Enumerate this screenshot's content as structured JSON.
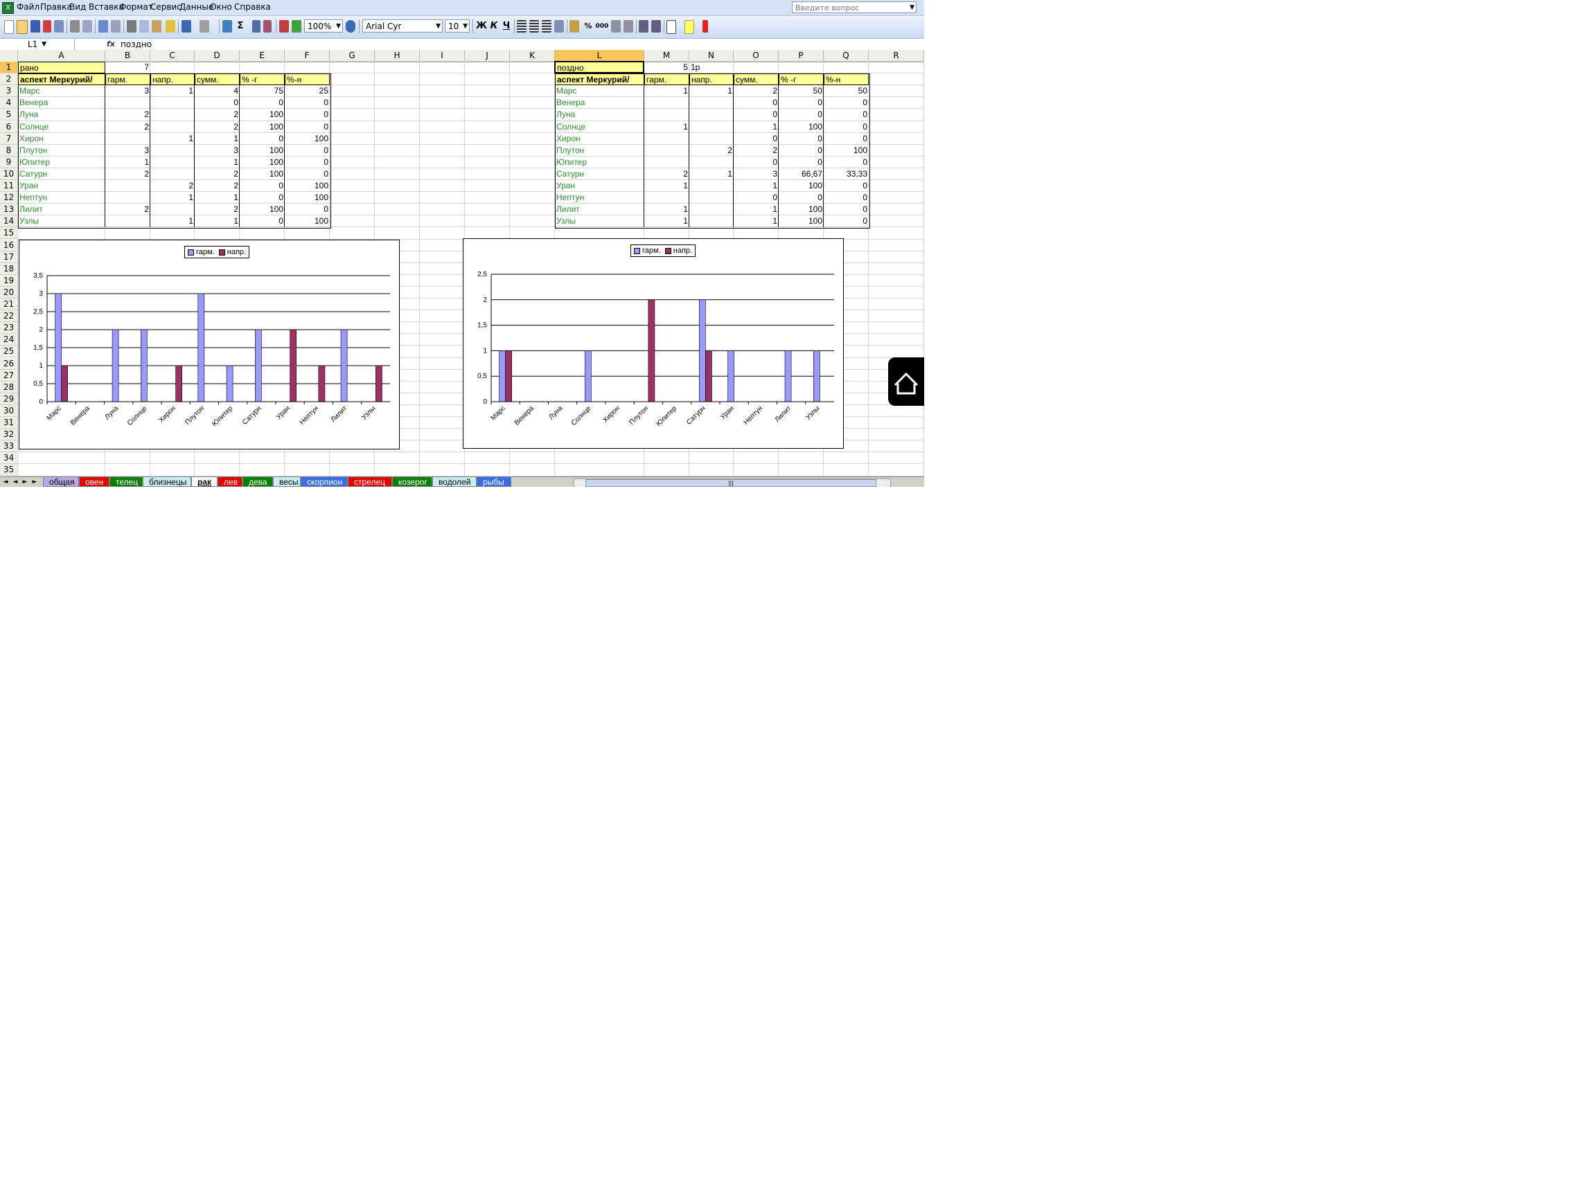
{
  "menu": [
    "Файл",
    "Правка",
    "Вид",
    "Вставка",
    "Формат",
    "Сервис",
    "Данные",
    "Окно",
    "Справка"
  ],
  "help_placeholder": "Введите вопрос",
  "toolbar": {
    "zoom": "100%",
    "font": "Arial Cyr",
    "size": "10",
    "bold": "Ж",
    "italic": "К",
    "underline": "Ч",
    "sigma": "Σ",
    "percent": "%",
    "thousands": "000"
  },
  "formula_bar": {
    "name_box": "L1",
    "fx": "fx",
    "value": "поздно"
  },
  "columns": [
    "A",
    "B",
    "C",
    "D",
    "E",
    "F",
    "G",
    "H",
    "I",
    "J",
    "K",
    "L",
    "M",
    "N",
    "O",
    "P",
    "Q",
    "R"
  ],
  "rows": [
    "1",
    "2",
    "3",
    "4",
    "5",
    "6",
    "7",
    "8",
    "9",
    "10",
    "11",
    "12",
    "13",
    "14",
    "15",
    "16",
    "17",
    "18",
    "19",
    "20",
    "21",
    "22",
    "23",
    "24",
    "25",
    "26",
    "27",
    "28",
    "29",
    "30",
    "31",
    "32",
    "33",
    "34",
    "35"
  ],
  "left_table": {
    "r1": [
      "рано",
      "7"
    ],
    "header": [
      "аспект Меркурий/",
      "гарм.",
      "напр.",
      "сумм.",
      "% -г",
      "%-н"
    ],
    "rows": [
      [
        "Марс",
        "3",
        "1",
        "4",
        "75",
        "25"
      ],
      [
        "Венера",
        "",
        "",
        "0",
        "0",
        "0"
      ],
      [
        "Луна",
        "2",
        "",
        "2",
        "100",
        "0"
      ],
      [
        "Солнце",
        "2",
        "",
        "2",
        "100",
        "0"
      ],
      [
        "Хирон",
        "",
        "1",
        "1",
        "0",
        "100"
      ],
      [
        "Плутон",
        "3",
        "",
        "3",
        "100",
        "0"
      ],
      [
        "Юпитер",
        "1",
        "",
        "1",
        "100",
        "0"
      ],
      [
        "Сатурн",
        "2",
        "",
        "2",
        "100",
        "0"
      ],
      [
        "Уран",
        "",
        "2",
        "2",
        "0",
        "100"
      ],
      [
        "Нептун",
        "",
        "1",
        "1",
        "0",
        "100"
      ],
      [
        "Лилит",
        "2",
        "",
        "2",
        "100",
        "0"
      ],
      [
        "Узлы",
        "",
        "1",
        "1",
        "0",
        "100"
      ]
    ]
  },
  "right_table": {
    "r1": [
      "поздно",
      "5",
      "1р"
    ],
    "header": [
      "аспект Меркурий/",
      "гарм.",
      "напр.",
      "сумм.",
      "% -г",
      "%-н"
    ],
    "rows": [
      [
        "Марс",
        "1",
        "1",
        "2",
        "50",
        "50"
      ],
      [
        "Венера",
        "",
        "",
        "0",
        "0",
        "0"
      ],
      [
        "Луна",
        "",
        "",
        "0",
        "0",
        "0"
      ],
      [
        "Солнце",
        "1",
        "",
        "1",
        "100",
        "0"
      ],
      [
        "Хирон",
        "",
        "",
        "0",
        "0",
        "0"
      ],
      [
        "Плутон",
        "",
        "2",
        "2",
        "0",
        "100"
      ],
      [
        "Юпитер",
        "",
        "",
        "0",
        "0",
        "0"
      ],
      [
        "Сатурн",
        "2",
        "1",
        "3",
        "66,67",
        "33,33"
      ],
      [
        "Уран",
        "1",
        "",
        "1",
        "100",
        "0"
      ],
      [
        "Нептун",
        "",
        "",
        "0",
        "0",
        "0"
      ],
      [
        "Лилит",
        "1",
        "",
        "1",
        "100",
        "0"
      ],
      [
        "Узлы",
        "1",
        "",
        "1",
        "100",
        "0"
      ]
    ]
  },
  "chart_data": [
    {
      "type": "bar",
      "categories": [
        "Марс",
        "Венера",
        "Луна",
        "Солнце",
        "Хирон",
        "Плутон",
        "Юпитер",
        "Сатурн",
        "Уран",
        "Нептун",
        "Лилит",
        "Узлы"
      ],
      "series": [
        {
          "name": "гарм.",
          "values": [
            3,
            0,
            2,
            2,
            0,
            3,
            1,
            2,
            0,
            0,
            2,
            0
          ],
          "color": "#9999ff"
        },
        {
          "name": "напр.",
          "values": [
            1,
            0,
            0,
            0,
            1,
            0,
            0,
            0,
            2,
            1,
            0,
            1
          ],
          "color": "#993366"
        }
      ],
      "ylim": [
        0,
        3.5
      ],
      "yticks": [
        "0",
        "0,5",
        "1",
        "1,5",
        "2",
        "2,5",
        "3",
        "3,5"
      ],
      "legend": "top-center",
      "grid": true
    },
    {
      "type": "bar",
      "categories": [
        "Марс",
        "Венера",
        "Луна",
        "Солнце",
        "Хирон",
        "Плутон",
        "Юпитер",
        "Сатурн",
        "Уран",
        "Нептун",
        "Лилит",
        "Узлы"
      ],
      "series": [
        {
          "name": "гарм.",
          "values": [
            1,
            0,
            0,
            1,
            0,
            0,
            0,
            2,
            1,
            0,
            1,
            1
          ],
          "color": "#9999ff"
        },
        {
          "name": "напр.",
          "values": [
            1,
            0,
            0,
            0,
            0,
            2,
            0,
            1,
            0,
            0,
            0,
            0
          ],
          "color": "#993366"
        }
      ],
      "ylim": [
        0,
        2.5
      ],
      "yticks": [
        "0",
        "0,5",
        "1",
        "1,5",
        "2",
        "2,5"
      ],
      "legend": "top-center",
      "grid": true
    }
  ],
  "sheet_tabs": [
    {
      "label": "общая",
      "color": "#b8a8e8"
    },
    {
      "label": "овен",
      "color": "#e00000"
    },
    {
      "label": "телец",
      "color": "#008000"
    },
    {
      "label": "близнецы",
      "color": "#c8f0f0"
    },
    {
      "label": "рак",
      "color": "#ffffff"
    },
    {
      "label": "лев",
      "color": "#e00000"
    },
    {
      "label": "дева",
      "color": "#008000"
    },
    {
      "label": "весы",
      "color": "#c8f0f0"
    },
    {
      "label": "скорпион",
      "color": "#3a6ee8"
    },
    {
      "label": "стрелец",
      "color": "#e00000"
    },
    {
      "label": "козерог",
      "color": "#008000"
    },
    {
      "label": "водолей",
      "color": "#c8f0f0"
    },
    {
      "label": "рыбы",
      "color": "#3a6ee8"
    }
  ],
  "active_tab": "рак",
  "scroll_thumb": "|||"
}
